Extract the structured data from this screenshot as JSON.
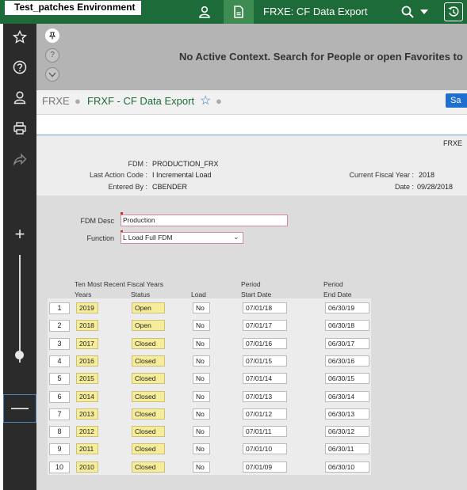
{
  "topbar": {
    "environment": "Test_patches Environment",
    "window_title": "FRXE: CF Data Export",
    "icons": [
      "user-icon",
      "document-icon",
      "search-icon",
      "chevron-down-icon",
      "history-icon"
    ]
  },
  "sidebar": {
    "icons": [
      "star-icon",
      "help-icon",
      "user-icon",
      "print-icon",
      "share-icon",
      "plus-icon",
      "minus-icon"
    ],
    "zoom_level": 0.9
  },
  "context": {
    "message": "No Active Context. Search for People or open Favorites to"
  },
  "breadcrumb": {
    "root": "FRXE",
    "current": "FRXF - CF Data Export",
    "save_label": "Sa"
  },
  "header": {
    "module_code": "FRXE",
    "fdm_label": "FDM :",
    "fdm_value": "PRODUCTION_FRX",
    "last_action_label": "Last Action Code :",
    "last_action_value": "I Incremental Load",
    "entered_by_label": "Entered By :",
    "entered_by_value": "CBENDER",
    "fiscal_year_label": "Current Fiscal Year :",
    "fiscal_year_value": "2018",
    "date_label": "Date :",
    "date_value": "09/28/2018"
  },
  "form": {
    "fdm_desc_label": "FDM Desc",
    "fdm_desc_value": "Production",
    "function_label": "Function",
    "function_value": "L Load Full FDM"
  },
  "table": {
    "group_header": "Ten Most Recent Fiscal Years",
    "period_header_1": "Period",
    "period_header_2": "Period",
    "columns": [
      "Years",
      "Status",
      "Load",
      "Start Date",
      "End Date"
    ],
    "rows": [
      {
        "n": "1",
        "year": "2019",
        "status": "Open",
        "load": "No",
        "start": "07/01/18",
        "end": "06/30/19"
      },
      {
        "n": "2",
        "year": "2018",
        "status": "Open",
        "load": "No",
        "start": "07/01/17",
        "end": "06/30/18"
      },
      {
        "n": "3",
        "year": "2017",
        "status": "Closed",
        "load": "No",
        "start": "07/01/16",
        "end": "06/30/17"
      },
      {
        "n": "4",
        "year": "2016",
        "status": "Closed",
        "load": "No",
        "start": "07/01/15",
        "end": "06/30/16"
      },
      {
        "n": "5",
        "year": "2015",
        "status": "Closed",
        "load": "No",
        "start": "07/01/14",
        "end": "06/30/15"
      },
      {
        "n": "6",
        "year": "2014",
        "status": "Closed",
        "load": "No",
        "start": "07/01/13",
        "end": "06/30/14"
      },
      {
        "n": "7",
        "year": "2013",
        "status": "Closed",
        "load": "No",
        "start": "07/01/12",
        "end": "06/30/13"
      },
      {
        "n": "8",
        "year": "2012",
        "status": "Closed",
        "load": "No",
        "start": "07/01/11",
        "end": "06/30/12"
      },
      {
        "n": "9",
        "year": "2011",
        "status": "Closed",
        "load": "No",
        "start": "07/01/10",
        "end": "06/30/11"
      },
      {
        "n": "10",
        "year": "2010",
        "status": "Closed",
        "load": "No",
        "start": "07/01/09",
        "end": "06/30/10"
      }
    ]
  },
  "colors": {
    "brand": "#1e6b3a",
    "accent": "#1f6fcf",
    "highlight": "#f6ed9b"
  }
}
